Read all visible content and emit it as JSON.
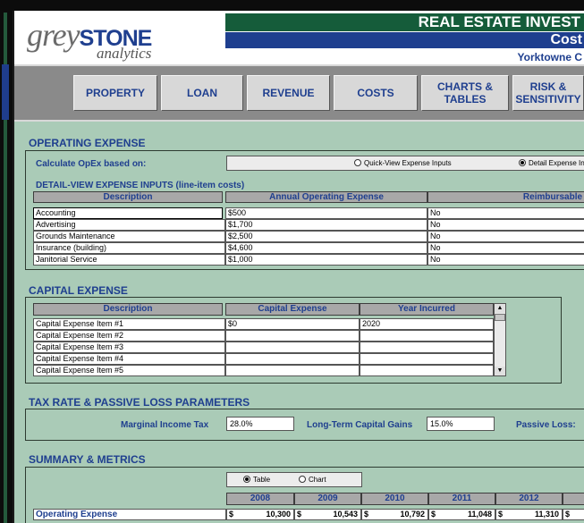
{
  "header": {
    "logo_grey": "grey",
    "logo_stone": "STONE",
    "logo_sub": "analytics",
    "title": "REAL ESTATE INVEST",
    "subtitle": "Cost",
    "property": "Yorktowne C"
  },
  "nav": [
    {
      "label": "PROPERTY"
    },
    {
      "label": "LOAN"
    },
    {
      "label": "REVENUE"
    },
    {
      "label": "COSTS"
    },
    {
      "label": "CHARTS & TABLES"
    },
    {
      "label": "RISK & SENSITIVITY"
    }
  ],
  "opex": {
    "title": "OPERATING EXPENSE",
    "calc_label": "Calculate OpEx based on:",
    "option_quick": "Quick-View Expense Inputs",
    "option_detail": "Detail Expense In",
    "detail_title": "DETAIL-VIEW EXPENSE INPUTS (line-item costs)",
    "columns": [
      "Description",
      "Annual Operating Expense",
      "Reimbursable"
    ],
    "rows": [
      {
        "desc": "Accounting",
        "amount": "$500",
        "reimb": "No"
      },
      {
        "desc": "Advertising",
        "amount": "$1,700",
        "reimb": "No"
      },
      {
        "desc": "Grounds Maintenance",
        "amount": "$2,500",
        "reimb": "No"
      },
      {
        "desc": "Insurance (building)",
        "amount": "$4,600",
        "reimb": "No"
      },
      {
        "desc": "Janitorial Service",
        "amount": "$1,000",
        "reimb": "No"
      }
    ]
  },
  "capex": {
    "title": "CAPITAL EXPENSE",
    "columns": [
      "Description",
      "Capital Expense",
      "Year Incurred"
    ],
    "rows": [
      {
        "desc": "Capital Expense Item #1",
        "amount": "$0",
        "year": "2020"
      },
      {
        "desc": "Capital Expense Item #2",
        "amount": "",
        "year": ""
      },
      {
        "desc": "Capital Expense Item #3",
        "amount": "",
        "year": ""
      },
      {
        "desc": "Capital Expense Item #4",
        "amount": "",
        "year": ""
      },
      {
        "desc": "Capital Expense Item #5",
        "amount": "",
        "year": ""
      }
    ]
  },
  "tax": {
    "title": "TAX RATE & PASSIVE LOSS PARAMETERS",
    "income_label": "Marginal Income Tax",
    "income_value": "28.0%",
    "capgains_label": "Long-Term Capital Gains",
    "capgains_value": "15.0%",
    "passive_label": "Passive Loss:"
  },
  "summary": {
    "title": "SUMMARY & METRICS",
    "option_table": "Table",
    "option_chart": "Chart",
    "years": [
      "2008",
      "2009",
      "2010",
      "2011",
      "2012"
    ],
    "row_label": "Operating Expense",
    "currency": "$",
    "values": [
      "10,300",
      "10,543",
      "10,792",
      "11,048",
      "11,310"
    ]
  }
}
